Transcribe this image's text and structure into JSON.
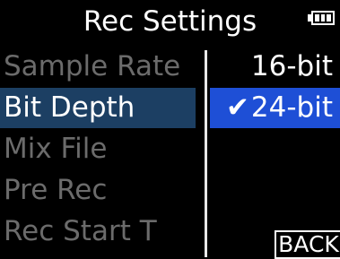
{
  "header": {
    "title": "Rec Settings",
    "battery_icon": "battery-icon",
    "battery_level": 1.0
  },
  "menu": {
    "items": [
      {
        "label": "Sample Rate",
        "state": "inactive"
      },
      {
        "label": "Bit Depth",
        "state": "selected"
      },
      {
        "label": "Mix File",
        "state": "inactive"
      },
      {
        "label": "Pre Rec",
        "state": "inactive"
      },
      {
        "label": "Rec Start T",
        "state": "inactive"
      }
    ]
  },
  "options": {
    "items": [
      {
        "label": "16-bit",
        "checked": false
      },
      {
        "label": "24-bit",
        "checked": true
      }
    ],
    "check_glyph": "✔"
  },
  "footer": {
    "back_label": "BACK"
  },
  "colors": {
    "background": "#000000",
    "menu_selected_bg": "#1c3f63",
    "option_selected_bg": "#1e4fd6",
    "inactive_text": "#6b6b6b",
    "active_text": "#ffffff"
  }
}
